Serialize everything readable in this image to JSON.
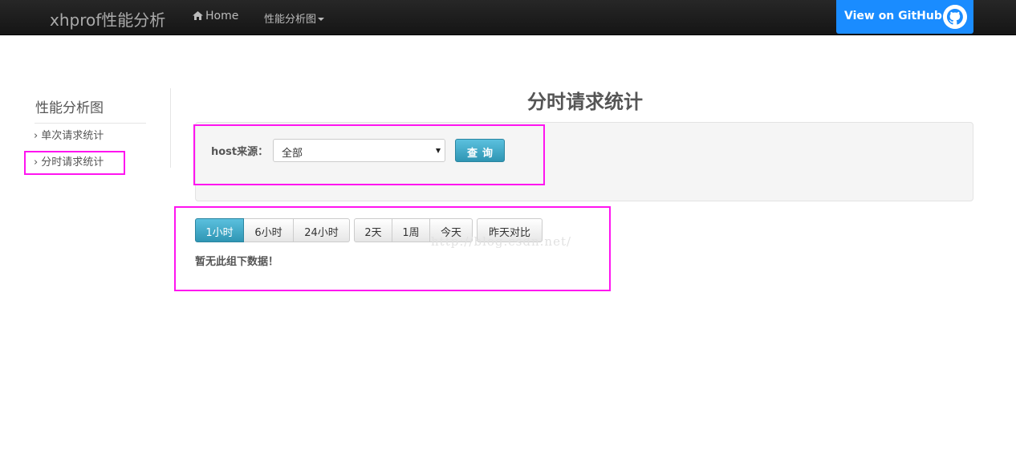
{
  "navbar": {
    "brand": "xhprof性能分析",
    "home_label": "Home",
    "home_icon": "home-icon",
    "dropdown_label": "性能分析图",
    "github_label": "View on GitHub",
    "github_icon": "github-octocat-icon",
    "github_color": "#1a8cff"
  },
  "sidebar": {
    "title": "性能分析图",
    "items": [
      {
        "label": "单次请求统计"
      },
      {
        "label": "分时请求统计"
      }
    ]
  },
  "main": {
    "title": "分时请求统计",
    "form": {
      "host_label": "host来源：",
      "host_value": "全部",
      "query_label": "查询"
    },
    "range_buttons": [
      "1小时",
      "6小时",
      "24小时"
    ],
    "day_buttons": [
      "2天",
      "1周",
      "今天"
    ],
    "compare_button": "昨天对比",
    "active_range": "1小时",
    "no_data": "暂无此组下数据！",
    "watermark": "http://blog.csdn.net/"
  },
  "colors": {
    "highlight": "#ff14f0",
    "active_button": "#2f96b4"
  }
}
